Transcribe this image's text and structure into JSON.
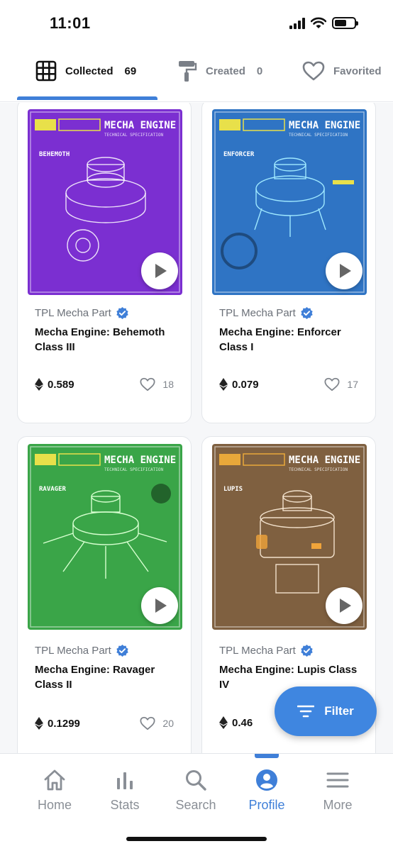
{
  "status_bar": {
    "time": "11:01"
  },
  "tabs": [
    {
      "label": "Collected",
      "count": "69",
      "icon": "grid-icon",
      "active": true
    },
    {
      "label": "Created",
      "count": "0",
      "icon": "paint-roller-icon",
      "active": false
    },
    {
      "label": "Favorited",
      "icon": "heart-icon",
      "active": false
    }
  ],
  "cards": [
    {
      "collection": "TPL Mecha Part",
      "title": "Mecha Engine: Behemoth Class III",
      "price": "0.589",
      "likes": "18",
      "art_label": "BEHEMOTH",
      "art_header": "MECHA ENGINE",
      "art_sub": "TECHNICAL SPECIFICATION",
      "color": "#7b2fd1"
    },
    {
      "collection": "TPL Mecha Part",
      "title": "Mecha Engine: Enforcer Class I",
      "price": "0.079",
      "likes": "17",
      "art_label": "ENFORCER",
      "art_header": "MECHA ENGINE",
      "art_sub": "TECHNICAL SPECIFICATION",
      "color": "#2f74c4"
    },
    {
      "collection": "TPL Mecha Part",
      "title": "Mecha Engine: Ravager Class II",
      "price": "0.1299",
      "likes": "20",
      "art_label": "RAVAGER",
      "art_header": "MECHA ENGINE",
      "art_sub": "TECHNICAL SPECIFICATION",
      "color": "#3aa548"
    },
    {
      "collection": "TPL Mecha Part",
      "title": "Mecha Engine: Lupis Class IV",
      "price": "0.46",
      "likes": "",
      "art_label": "LUPIS",
      "art_header": "MECHA ENGINE",
      "art_sub": "TECHNICAL SPECIFICATION",
      "color": "#7f6040"
    }
  ],
  "filter_button": {
    "label": "Filter"
  },
  "bottom_nav": [
    {
      "label": "Home",
      "icon": "home-icon"
    },
    {
      "label": "Stats",
      "icon": "stats-icon"
    },
    {
      "label": "Search",
      "icon": "search-icon"
    },
    {
      "label": "Profile",
      "icon": "profile-icon",
      "active": true
    },
    {
      "label": "More",
      "icon": "menu-icon"
    }
  ],
  "colors": {
    "accent": "#3f7fd8",
    "filter": "#3f86e0",
    "verified": "#3f7fd8"
  }
}
